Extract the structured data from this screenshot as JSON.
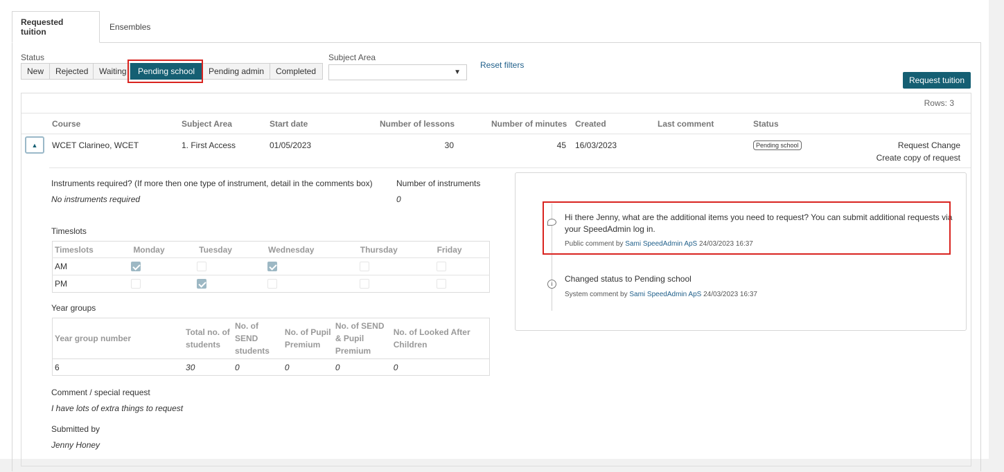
{
  "tabs": [
    "Requested tuition",
    "Ensembles"
  ],
  "filters": {
    "status_label": "Status",
    "statuses": [
      "New",
      "Rejected",
      "Waiting",
      "Pending school",
      "Pending admin",
      "Completed"
    ],
    "active_status": "Pending school",
    "subject_area_label": "Subject Area",
    "subject_area_value": "",
    "reset_label": "Reset filters"
  },
  "request_button": "Request tuition",
  "grid": {
    "rows_label": "Rows: 3",
    "columns": [
      "Course",
      "Subject Area",
      "Start date",
      "Number of lessons",
      "Number of minutes",
      "Created",
      "Last comment",
      "Status"
    ],
    "row": {
      "course": "WCET Clarineo, WCET",
      "subject_area": "1. First Access",
      "start_date": "01/05/2023",
      "lessons": "30",
      "minutes": "45",
      "created": "16/03/2023",
      "last_comment": "",
      "status": "Pending school",
      "action_change": "Request Change",
      "action_copy": "Create copy of request"
    }
  },
  "detail": {
    "instruments_label": "Instruments required? (If more then one type of instrument, detail in the comments box)",
    "instruments_value": "No instruments required",
    "num_instruments_label": "Number of instruments",
    "num_instruments_value": "0",
    "timeslots_label": "Timeslots",
    "timeslots_table": {
      "headers": [
        "Timeslots",
        "Monday",
        "Tuesday",
        "Wednesday",
        "Thursday",
        "Friday"
      ],
      "rows": [
        {
          "name": "AM",
          "checked": [
            true,
            false,
            true,
            false,
            false
          ]
        },
        {
          "name": "PM",
          "checked": [
            false,
            true,
            false,
            false,
            false
          ]
        }
      ]
    },
    "year_groups_label": "Year groups",
    "year_groups_table": {
      "headers": [
        "Year group number",
        "Total no. of students",
        "No. of SEND students",
        "No. of Pupil Premium",
        "No. of SEND & Pupil Premium",
        "No. of Looked After Children"
      ],
      "row": [
        "6",
        "30",
        "0",
        "0",
        "0",
        "0"
      ]
    },
    "comment_label": "Comment / special request",
    "comment_value": "I have lots of extra things to request",
    "submitted_label": "Submitted by",
    "submitted_value": "Jenny Honey"
  },
  "comments": [
    {
      "text": "Hi there Jenny, what are the additional items you need to request? You can submit additional requests via your SpeedAdmin log in.",
      "meta_prefix": "Public comment by",
      "author": "Sami SpeedAdmin ApS",
      "date": "24/03/2023 16:37",
      "icon": "speech-bubble-icon"
    },
    {
      "text": "Changed status to Pending school",
      "meta_prefix": "System comment by",
      "author": "Sami SpeedAdmin ApS",
      "date": "24/03/2023 16:37",
      "icon": "info-icon"
    }
  ],
  "colors": {
    "primary": "#155f73",
    "highlight": "#d9231f",
    "link": "#1f5f8a"
  }
}
